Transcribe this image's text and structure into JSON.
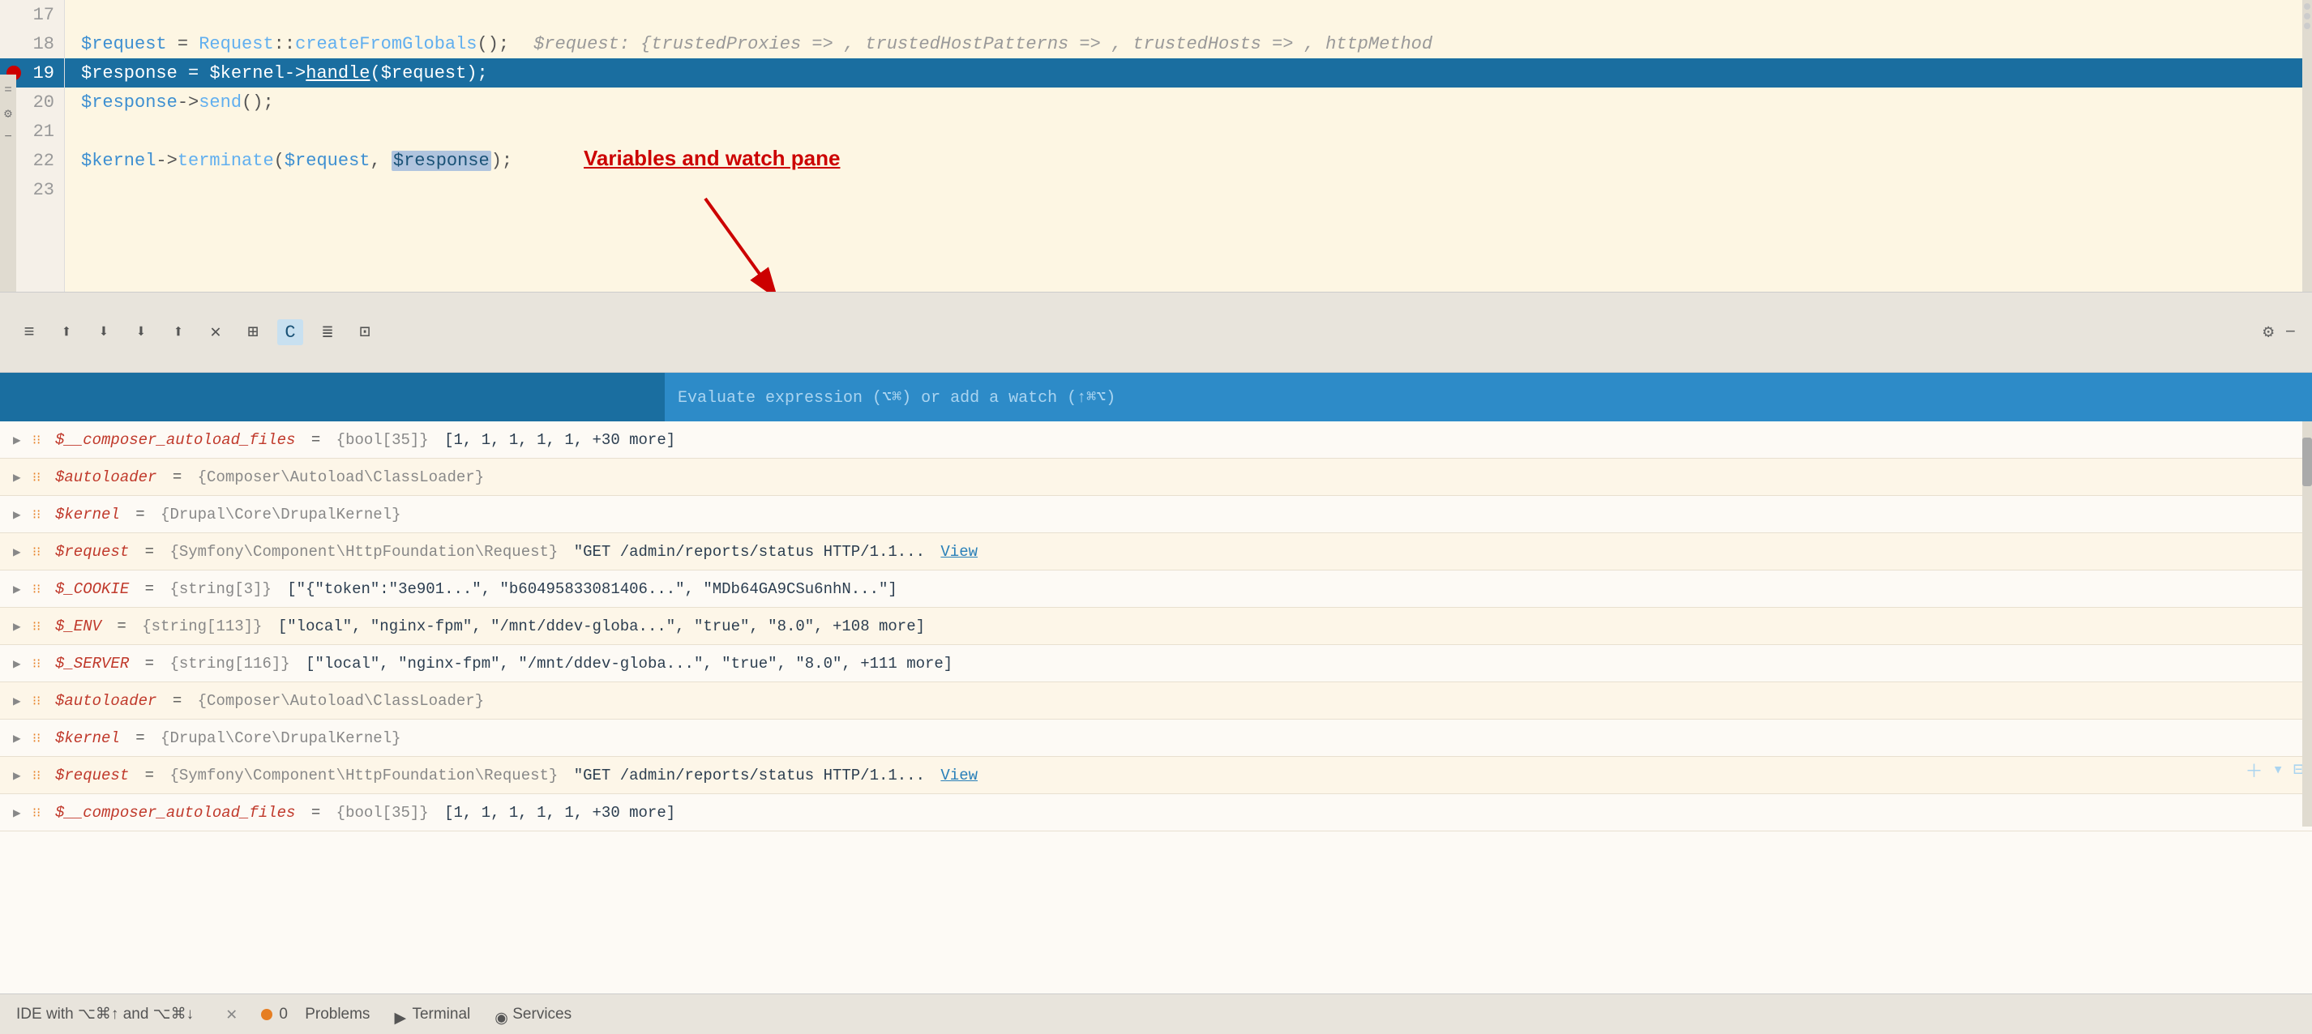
{
  "editor": {
    "lines": [
      {
        "num": 17,
        "content": null,
        "active": false
      },
      {
        "num": 18,
        "content": "$request = Request::createFromGlobals();",
        "comment": "  $request: {trustedProxies => , trustedHostPatterns => , trustedHosts => , httpMethod",
        "active": false
      },
      {
        "num": 19,
        "content": "$response = $kernel->handle($request);",
        "active": true,
        "breakpoint": true
      },
      {
        "num": 20,
        "content": "$response->send();",
        "active": false
      },
      {
        "num": 21,
        "content": null,
        "active": false
      },
      {
        "num": 22,
        "content": "$kernel->terminate($request, $response);",
        "active": false
      },
      {
        "num": 23,
        "content": null,
        "active": false
      }
    ]
  },
  "annotation": {
    "label": "Variables and watch pane"
  },
  "toolbar": {
    "icons": [
      "≡",
      "⬆",
      "⬇",
      "⬇",
      "⬆",
      "✕",
      "⊞",
      "C",
      "≣",
      "⊡"
    ]
  },
  "debug": {
    "eval_placeholder": "Evaluate expression (⌥⌘) or add a watch (↑⌘⌥)",
    "variables": [
      {
        "name": "$__composer_autoload_files",
        "type": "{bool[35]}",
        "value": "[1, 1, 1, 1, 1, +30 more]",
        "link": null
      },
      {
        "name": "$autoloader",
        "type": "{Composer\\Autoload\\ClassLoader}",
        "value": "",
        "link": null
      },
      {
        "name": "$kernel",
        "type": "{Drupal\\Core\\DrupalKernel}",
        "value": "",
        "link": null
      },
      {
        "name": "$request",
        "type": "{Symfony\\Component\\HttpFoundation\\Request}",
        "value": "\"GET /admin/reports/status HTTP/1.1...",
        "link": "View"
      },
      {
        "name": "$_COOKIE",
        "type": "{string[3]}",
        "value": "[\"{\"token\":\"3e901...\", \"b60495833081406...\", \"MDb64GA9CSu6nhN...\"]",
        "link": null
      },
      {
        "name": "$_ENV",
        "type": "{string[113]}",
        "value": "[\"local\", \"nginx-fpm\", \"/mnt/ddev-globa...\", \"true\", \"8.0\", +108 more]",
        "link": null
      },
      {
        "name": "$_SERVER",
        "type": "{string[116]}",
        "value": "[\"local\", \"nginx-fpm\", \"/mnt/ddev-globa...\", \"true\", \"8.0\", +111 more]",
        "link": null
      },
      {
        "name": "$autoloader",
        "type": "{Composer\\Autoload\\ClassLoader}",
        "value": "",
        "link": null
      },
      {
        "name": "$kernel",
        "type": "{Drupal\\Core\\DrupalKernel}",
        "value": "",
        "link": null
      },
      {
        "name": "$request",
        "type": "{Symfony\\Component\\HttpFoundation\\Request}",
        "value": "\"GET /admin/reports/status HTTP/1.1...",
        "link": "View"
      },
      {
        "name": "$__composer_autoload_files",
        "type": "{bool[35]}",
        "value": "[1, 1, 1, 1, 1, +30 more]",
        "link": null
      }
    ]
  },
  "statusbar": {
    "items": [
      {
        "label": "0",
        "has_dot": true,
        "dot_color": "orange"
      },
      {
        "label": "Problems",
        "has_dot": false
      },
      {
        "label": "Terminal",
        "has_dot": false
      },
      {
        "label": "Services",
        "has_dot": false
      }
    ],
    "hint": "IDE with ⌥⌘↑ and ⌥⌘↓"
  }
}
